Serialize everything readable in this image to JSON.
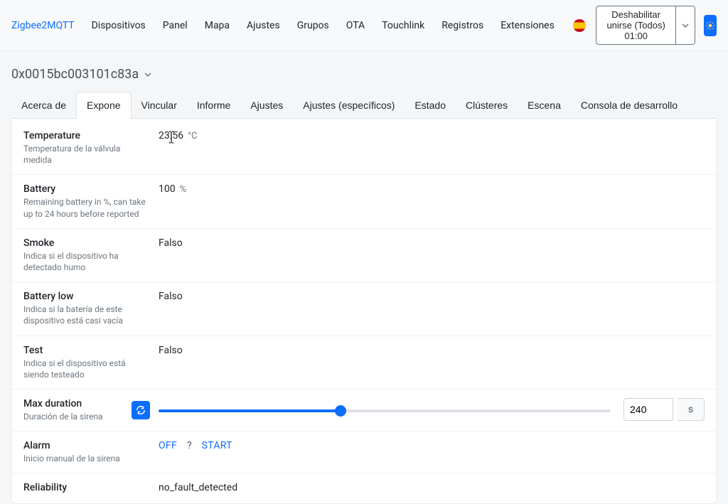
{
  "nav": {
    "brand": "Zigbee2MQTT",
    "items": [
      "Dispositivos",
      "Panel",
      "Mapa",
      "Ajustes",
      "Grupos",
      "OTA",
      "Touchlink",
      "Registros",
      "Extensiones"
    ],
    "permit_label": "Deshabilitar unirse (Todos) 01:00"
  },
  "device": {
    "ieee": "0x0015bc003101c83a"
  },
  "tabs": {
    "items": [
      "Acerca de",
      "Expone",
      "Vincular",
      "Informe",
      "Ajustes",
      "Ajustes (específicos)",
      "Estado",
      "Clústeres",
      "Escena",
      "Consola de desarrollo"
    ],
    "active_index": 1
  },
  "features": {
    "temperature": {
      "name": "Temperature",
      "desc": "Temperatura de la válvula medida",
      "value": "23.56",
      "unit": "°C"
    },
    "battery": {
      "name": "Battery",
      "desc": "Remaining battery in %, can take up to 24 hours before reported",
      "value": "100",
      "unit": "%"
    },
    "smoke": {
      "name": "Smoke",
      "desc": "Indica si el dispositivo ha detectado humo",
      "value": "Falso"
    },
    "battery_low": {
      "name": "Battery low",
      "desc": "Indica si la batería de este dispositivo está casi vacía",
      "value": "Falso"
    },
    "test": {
      "name": "Test",
      "desc": "Indica si el dispositivo está siendo testeado",
      "value": "Falso"
    },
    "max_duration": {
      "name": "Max duration",
      "desc": "Duración de la sirena",
      "value": "240",
      "unit": "s"
    },
    "alarm": {
      "name": "Alarm",
      "desc": "Inicio manual de la sirena",
      "options": {
        "off": "OFF",
        "unknown": "?",
        "start": "START"
      }
    },
    "reliability": {
      "name": "Reliability",
      "desc": "",
      "value": "no_fault_detected"
    }
  }
}
